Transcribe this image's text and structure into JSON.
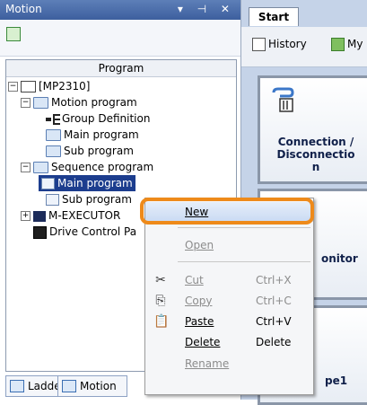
{
  "motion_pane": {
    "title": "Motion",
    "controls": "▾ ⊣ ✕",
    "tree_header": "Program",
    "nodes": {
      "root": "[MP2310]",
      "motion_program": "Motion program",
      "group_definition": "Group Definition",
      "main_program_1": "Main program",
      "sub_program_1": "Sub program",
      "sequence_program": "Sequence program",
      "main_program_2": "Main program",
      "sub_program_2": "Sub program",
      "m_executor": "M-EXECUTOR",
      "drive_control": "Drive Control Pa"
    },
    "tabs": {
      "ladder": "Ladder",
      "motion": "Motion"
    }
  },
  "start_pane": {
    "tab": "Start",
    "history": "History",
    "my": "My",
    "tile1": {
      "line1": "Connection /",
      "line2": "Disconnectio",
      "line3": "n"
    },
    "tile2": "onitor",
    "tile3": "pe1"
  },
  "context_menu": {
    "new": "New",
    "open": "Open",
    "cut": "Cut",
    "cut_sc": "Ctrl+X",
    "copy": "Copy",
    "copy_sc": "Ctrl+C",
    "paste": "Paste",
    "paste_sc": "Ctrl+V",
    "delete": "Delete",
    "delete_sc": "Delete",
    "rename": "Rename"
  },
  "colors": {
    "highlight_callout": "#ee8a1a",
    "selection": "#1c3d8e",
    "titlebar": "#4a6dad"
  }
}
